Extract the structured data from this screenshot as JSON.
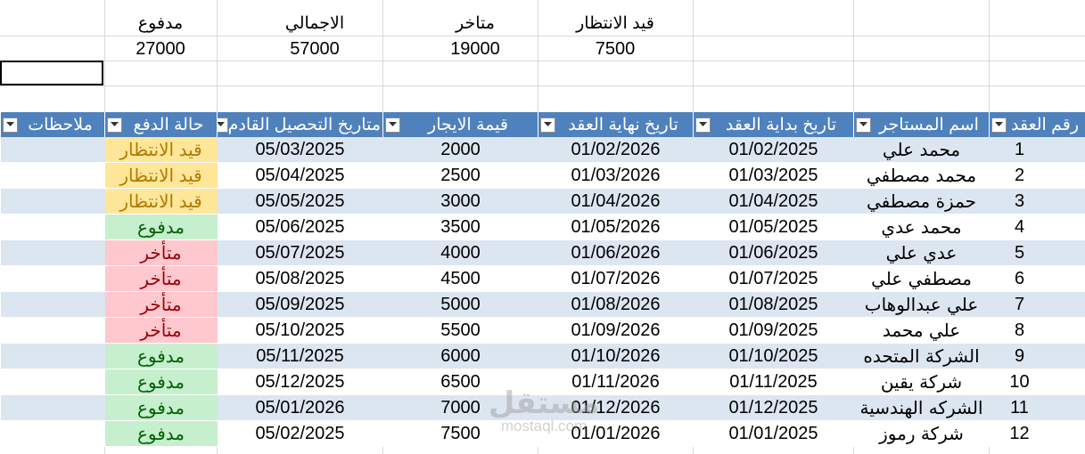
{
  "summary": [
    {
      "label": "مدفوع",
      "value": "27000"
    },
    {
      "label": "الاجمالي",
      "value": "57000"
    },
    {
      "label": "متاخر",
      "value": "19000"
    },
    {
      "label": "قيد الانتظار",
      "value": "7500"
    }
  ],
  "table": {
    "headers": {
      "contract_no": "رقم العقد",
      "tenant": "اسم المستاجر",
      "start": "تاريخ  بداية العقد",
      "end": "تاريخ نهاية العقد",
      "rent": "قيمة الايجار",
      "next_due": "متاريخ التحصيل القادم",
      "status": "حالة الدفع",
      "notes": "ملاحظات"
    },
    "rows": [
      {
        "contract_no": "1",
        "tenant": "محمد علي",
        "start": "01/02/2025",
        "end": "01/02/2026",
        "rent": "2000",
        "next_due": "05/03/2025",
        "status": "قيد الانتظار",
        "status_kind": "pending"
      },
      {
        "contract_no": "2",
        "tenant": "محمد مصطفي",
        "start": "01/03/2025",
        "end": "01/03/2026",
        "rent": "2500",
        "next_due": "05/04/2025",
        "status": "قيد الانتظار",
        "status_kind": "pending"
      },
      {
        "contract_no": "3",
        "tenant": "حمزة مصطفي",
        "start": "01/04/2025",
        "end": "01/04/2026",
        "rent": "3000",
        "next_due": "05/05/2025",
        "status": "قيد الانتظار",
        "status_kind": "pending"
      },
      {
        "contract_no": "4",
        "tenant": "محمد عدي",
        "start": "01/05/2025",
        "end": "01/05/2026",
        "rent": "3500",
        "next_due": "05/06/2025",
        "status": "مدفوع",
        "status_kind": "paid"
      },
      {
        "contract_no": "5",
        "tenant": "عدي علي",
        "start": "01/06/2025",
        "end": "01/06/2026",
        "rent": "4000",
        "next_due": "05/07/2025",
        "status": "متأخر",
        "status_kind": "late"
      },
      {
        "contract_no": "6",
        "tenant": "مصطفي علي",
        "start": "01/07/2025",
        "end": "01/07/2026",
        "rent": "4500",
        "next_due": "05/08/2025",
        "status": "متأخر",
        "status_kind": "late"
      },
      {
        "contract_no": "7",
        "tenant": "علي عبدالوهاب",
        "start": "01/08/2025",
        "end": "01/08/2026",
        "rent": "5000",
        "next_due": "05/09/2025",
        "status": "متأخر",
        "status_kind": "late"
      },
      {
        "contract_no": "8",
        "tenant": "علي محمد",
        "start": "01/09/2025",
        "end": "01/09/2026",
        "rent": "5500",
        "next_due": "05/10/2025",
        "status": "متأخر",
        "status_kind": "late"
      },
      {
        "contract_no": "9",
        "tenant": "الشركة المتحده",
        "start": "01/10/2025",
        "end": "01/10/2026",
        "rent": "6000",
        "next_due": "05/11/2025",
        "status": "مدفوع",
        "status_kind": "paid"
      },
      {
        "contract_no": "10",
        "tenant": "شركة يقين",
        "start": "01/11/2025",
        "end": "01/11/2026",
        "rent": "6500",
        "next_due": "05/12/2025",
        "status": "مدفوع",
        "status_kind": "paid"
      },
      {
        "contract_no": "11",
        "tenant": "الشركه الهندسية",
        "start": "01/12/2025",
        "end": "01/12/2026",
        "rent": "7000",
        "next_due": "05/01/2026",
        "status": "مدفوع",
        "status_kind": "paid"
      },
      {
        "contract_no": "12",
        "tenant": "شركة رموز",
        "start": "01/01/2025",
        "end": "01/01/2026",
        "rent": "7500",
        "next_due": "05/02/2025",
        "status": "مدفوع",
        "status_kind": "paid"
      }
    ]
  },
  "watermark": {
    "arabic": "مستقل",
    "latin": "mostaql.com"
  },
  "icons": {
    "filter": "dropdown-arrow-icon"
  },
  "colors": {
    "header": "#4f81bd",
    "band": "#dce6f1",
    "pending": "#ffe699",
    "paid": "#c6efce",
    "late": "#ffc7ce"
  }
}
